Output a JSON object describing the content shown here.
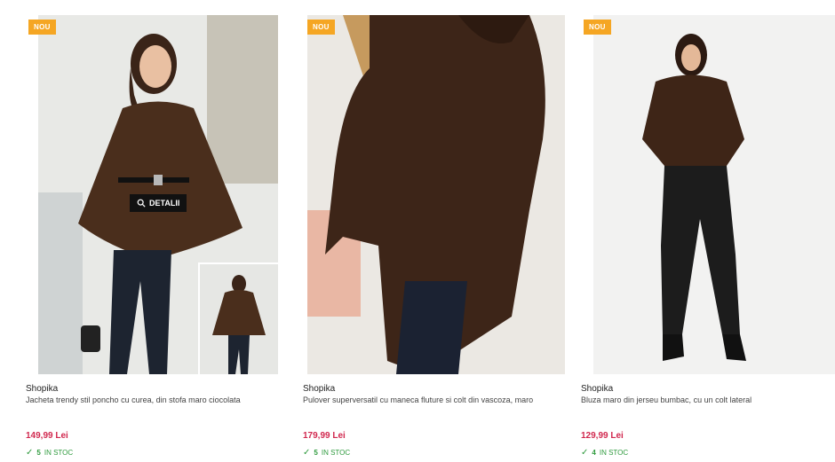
{
  "products": [
    {
      "badge": "NOU",
      "brand": "Shopika",
      "title": "Jacheta trendy stil poncho cu curea, din stofa maro ciocolata",
      "price": "149,99 Lei",
      "stock_qty": "5",
      "stock_label": "IN STOC",
      "details_label": "DETALII"
    },
    {
      "badge": "NOU",
      "brand": "Shopika",
      "title": "Pulover superversatil cu maneca fluture si colt din vascoza, maro",
      "price": "179,99 Lei",
      "stock_qty": "5",
      "stock_label": "IN STOC"
    },
    {
      "badge": "NOU",
      "brand": "Shopika",
      "title": "Bluza maro din jerseu bumbac, cu un colt lateral",
      "price": "129,99 Lei",
      "stock_qty": "4",
      "stock_label": "IN STOC"
    }
  ],
  "colors": {
    "badge": "#f5a623",
    "price": "#d1294f",
    "stock": "#2e9a3d",
    "garment": "#4a2e1c"
  }
}
